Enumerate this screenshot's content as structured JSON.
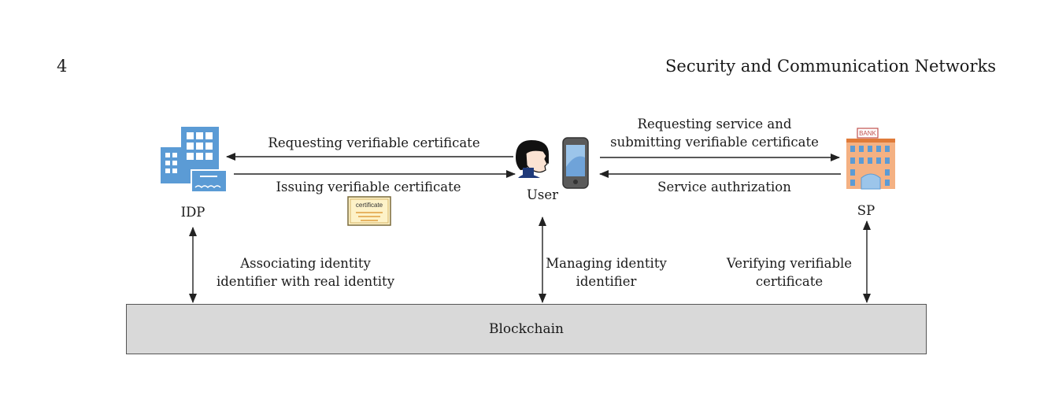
{
  "header": {
    "page_number": "4",
    "journal_title": "Security and Communication Networks"
  },
  "figure": {
    "entities": {
      "idp": "IDP",
      "user": "User",
      "sp": "SP"
    },
    "arrows": {
      "req_cert": "Requesting verifiable certificate",
      "issue_cert": "Issuing verifiable certificate",
      "req_service_line1": "Requesting service and",
      "req_service_line2": "submitting verifiable certificate",
      "service_auth": "Service authrization",
      "assoc_line1": "Associating identity",
      "assoc_line2": "identifier with real identity",
      "manage_line1": "Managing identity",
      "manage_line2": "identifier",
      "verify_line1": "Verifying verifiable",
      "verify_line2": "certificate"
    },
    "certificate_label": "certificate",
    "bank_label": "BANK",
    "blockchain": "Blockchain"
  },
  "colors": {
    "building_blue": "#5b9bd5",
    "bank_orange": "#f4b183",
    "blockchain_fill": "#d9d9d9"
  }
}
